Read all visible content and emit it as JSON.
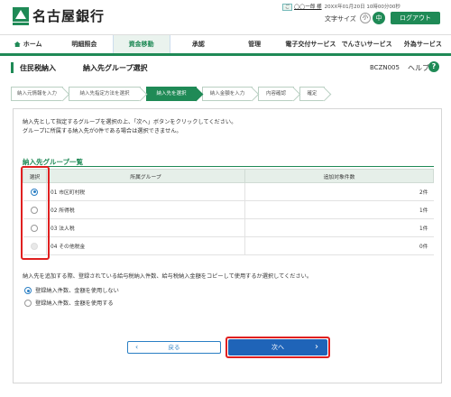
{
  "header": {
    "bank_name": "名古屋銀行",
    "user_line": {
      "name": "◯◯一郎 様",
      "login_info": "20XX年01月20日 10時00分00秒"
    },
    "font_size_label": "文字サイズ",
    "font_sizes": [
      "小",
      "中",
      "大"
    ],
    "font_size_selected": "中",
    "logout_label": "ログアウト"
  },
  "nav": {
    "items": [
      {
        "label": "ホーム",
        "icon": "home-icon"
      },
      {
        "label": "明細照会"
      },
      {
        "label": "資金移動",
        "active": true
      },
      {
        "label": "承認"
      },
      {
        "label": "管理"
      },
      {
        "label": "電子交付サービス"
      },
      {
        "label": "でんさいサービス"
      },
      {
        "label": "外為サービス"
      }
    ]
  },
  "title": {
    "category": "住民税納入",
    "page": "納入先グループ選択",
    "screen_id": "BCZN005",
    "help": "ヘルプ"
  },
  "steps": [
    {
      "label": "納入元情報を入力"
    },
    {
      "label": "納入先指定方法を選択"
    },
    {
      "label": "納入先を選択",
      "active": true
    },
    {
      "label": "納入金額を入力"
    },
    {
      "label": "内容確認"
    },
    {
      "label": "確定"
    }
  ],
  "intro": {
    "line1": "納入先として指定するグループを選択の上、「次へ」ボタンをクリックしてください。",
    "line2": "グループに所属する納入先が0件である場合は選択できません。"
  },
  "group_list": {
    "title": "納入先グループ一覧",
    "columns": [
      "選択",
      "所属グループ",
      "追加対象件数"
    ],
    "rows": [
      {
        "group": "01 市区町村税",
        "count": "2件",
        "state": "selected"
      },
      {
        "group": "02 所得税",
        "count": "1件",
        "state": "unselected"
      },
      {
        "group": "03 法人税",
        "count": "1件",
        "state": "unselected"
      },
      {
        "group": "04 その他税金",
        "count": "0件",
        "state": "disabled"
      }
    ]
  },
  "copy_option": {
    "question": "納入先を追加する際、登録されている給与税納入件数、給与税納入金額をコピーして使用するか選択してください。",
    "options": [
      {
        "label": "登録納入件数、金額を使用しない",
        "selected": true
      },
      {
        "label": "登録納入件数、金額を使用する",
        "selected": false
      }
    ]
  },
  "buttons": {
    "back": "戻る",
    "next": "次へ"
  },
  "colors": {
    "brand_green": "#1f8a56",
    "primary_blue": "#1f64b8",
    "highlight_red": "#e02020"
  }
}
